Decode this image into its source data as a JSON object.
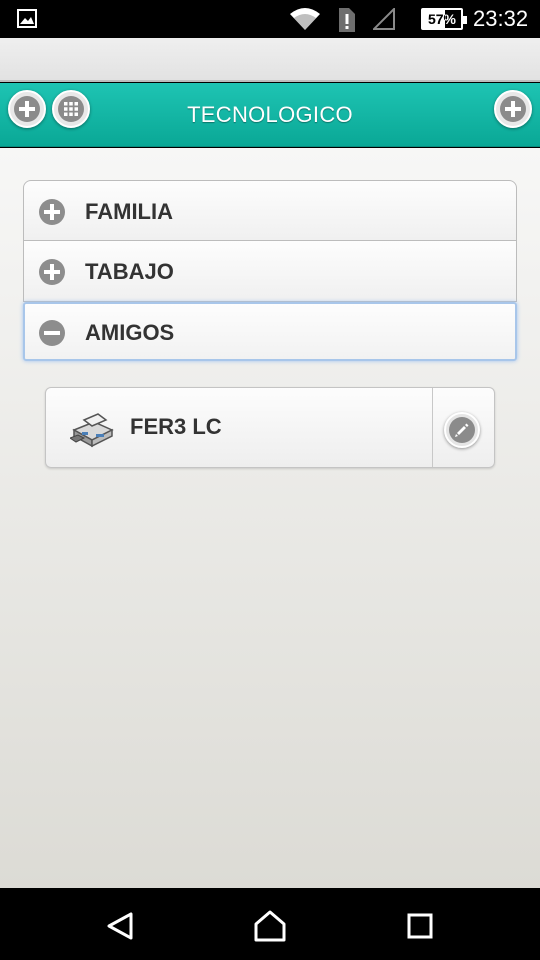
{
  "status_bar": {
    "battery_text": "57%",
    "battery_level": 0.57,
    "time": "23:32",
    "icons": [
      "gallery-icon",
      "wifi-icon",
      "alert-icon",
      "signal-icon",
      "battery-icon"
    ]
  },
  "header": {
    "title": "TECNOLOGICO",
    "left_buttons": [
      "add-icon",
      "grid-icon"
    ],
    "right_buttons": [
      "add-icon"
    ]
  },
  "groups": [
    {
      "label": "FAMILIA",
      "icon": "plus-icon",
      "expanded": false
    },
    {
      "label": "TABAJO",
      "icon": "plus-icon",
      "expanded": false
    },
    {
      "label": "AMIGOS",
      "icon": "minus-icon",
      "expanded": true
    }
  ],
  "devices": [
    {
      "name": "FER3 LC",
      "icon": "printer-icon",
      "action_icon": "pencil-icon"
    }
  ],
  "nav": [
    "back-icon",
    "home-icon",
    "recents-icon"
  ],
  "colors": {
    "header_bg": "#10b5a4",
    "icon_gray": "#8b8b8b",
    "text_dark": "#333333",
    "active_border": "#a8c6ea"
  }
}
